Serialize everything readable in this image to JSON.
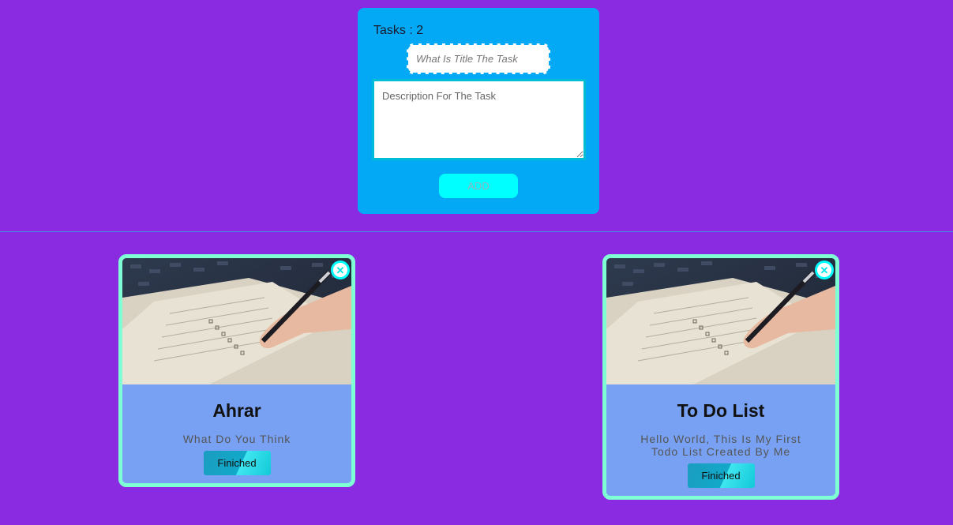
{
  "form": {
    "tasks_label": "Tasks : 2",
    "title_placeholder": "What Is Title The Task",
    "description_placeholder": "Description For The Task",
    "add_label": "ADD"
  },
  "cards": [
    {
      "title": "Ahrar",
      "description": "What Do You Think",
      "button_label": "Finiched",
      "close_icon": "close-icon"
    },
    {
      "title": "To Do List",
      "description": "Hello World, This Is My First Todo List Created By Me",
      "button_label": "Finiched",
      "close_icon": "close-icon"
    }
  ],
  "colors": {
    "background": "#8a2be2",
    "form_panel": "#03a9f4",
    "add_button": "#00ffff",
    "card_body": "#78a1f3",
    "card_border": "#7fffd4"
  }
}
